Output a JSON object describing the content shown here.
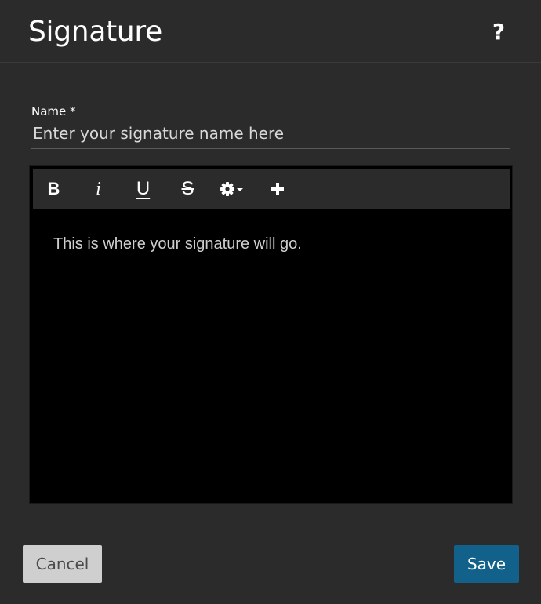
{
  "dialog": {
    "title": "Signature",
    "help_label": "?"
  },
  "name_field": {
    "label": "Name *",
    "value": "",
    "placeholder": "Enter your signature name here"
  },
  "toolbar": {
    "bold_label": "B",
    "italic_label": "i",
    "underline_label": "U",
    "strike_label": "S",
    "settings_icon": "gear-dropdown-icon",
    "insert_icon": "plus-icon"
  },
  "editor": {
    "content": "This is where your signature will go."
  },
  "footer": {
    "cancel_label": "Cancel",
    "save_label": "Save"
  },
  "colors": {
    "background": "#2b2b2b",
    "editor_background": "#000000",
    "save_accent": "#12618b",
    "cancel_background": "#cfcfcf"
  }
}
